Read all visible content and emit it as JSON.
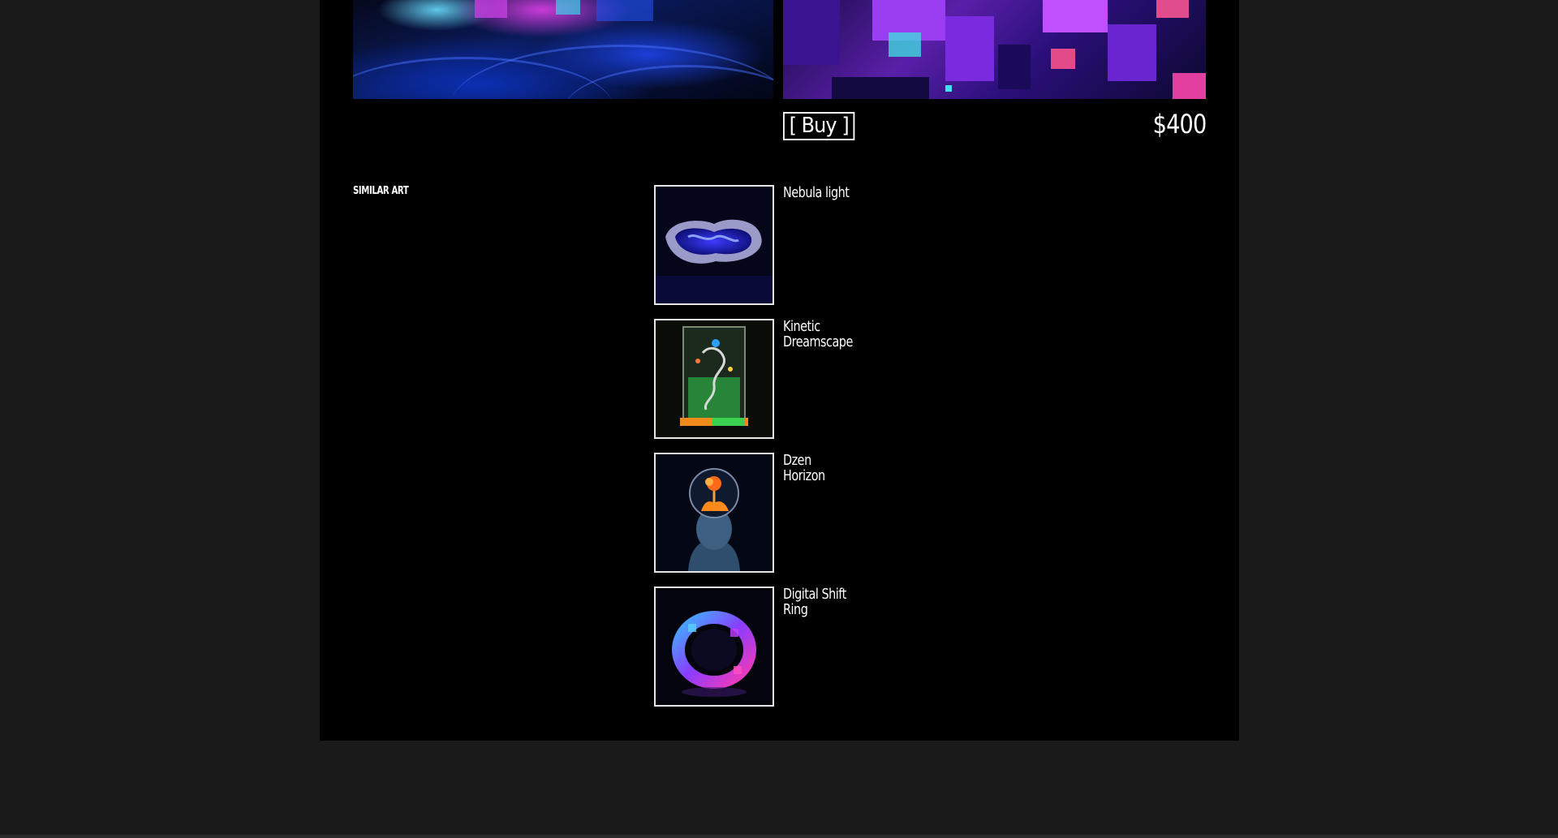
{
  "product": {
    "buy_label": "[  Buy  ]",
    "price": "$400"
  },
  "similar": {
    "heading": "SIMILAR ART",
    "items": [
      {
        "name": "Nebula light",
        "thumb": "glowing-blue-sculpture"
      },
      {
        "name": "Kinetic Dreamscape",
        "thumb": "neon-glass-cube-sculpture"
      },
      {
        "name": "Dzen Horizon",
        "thumb": "head-with-glass-dome"
      },
      {
        "name": "Digital Shift Ring",
        "thumb": "iridescent-ring"
      }
    ]
  },
  "colors": {
    "page_bg": "#1a1a1a",
    "panel_bg": "#000000",
    "text": "#ffffff",
    "thumb_border": "#e6e6e6"
  }
}
